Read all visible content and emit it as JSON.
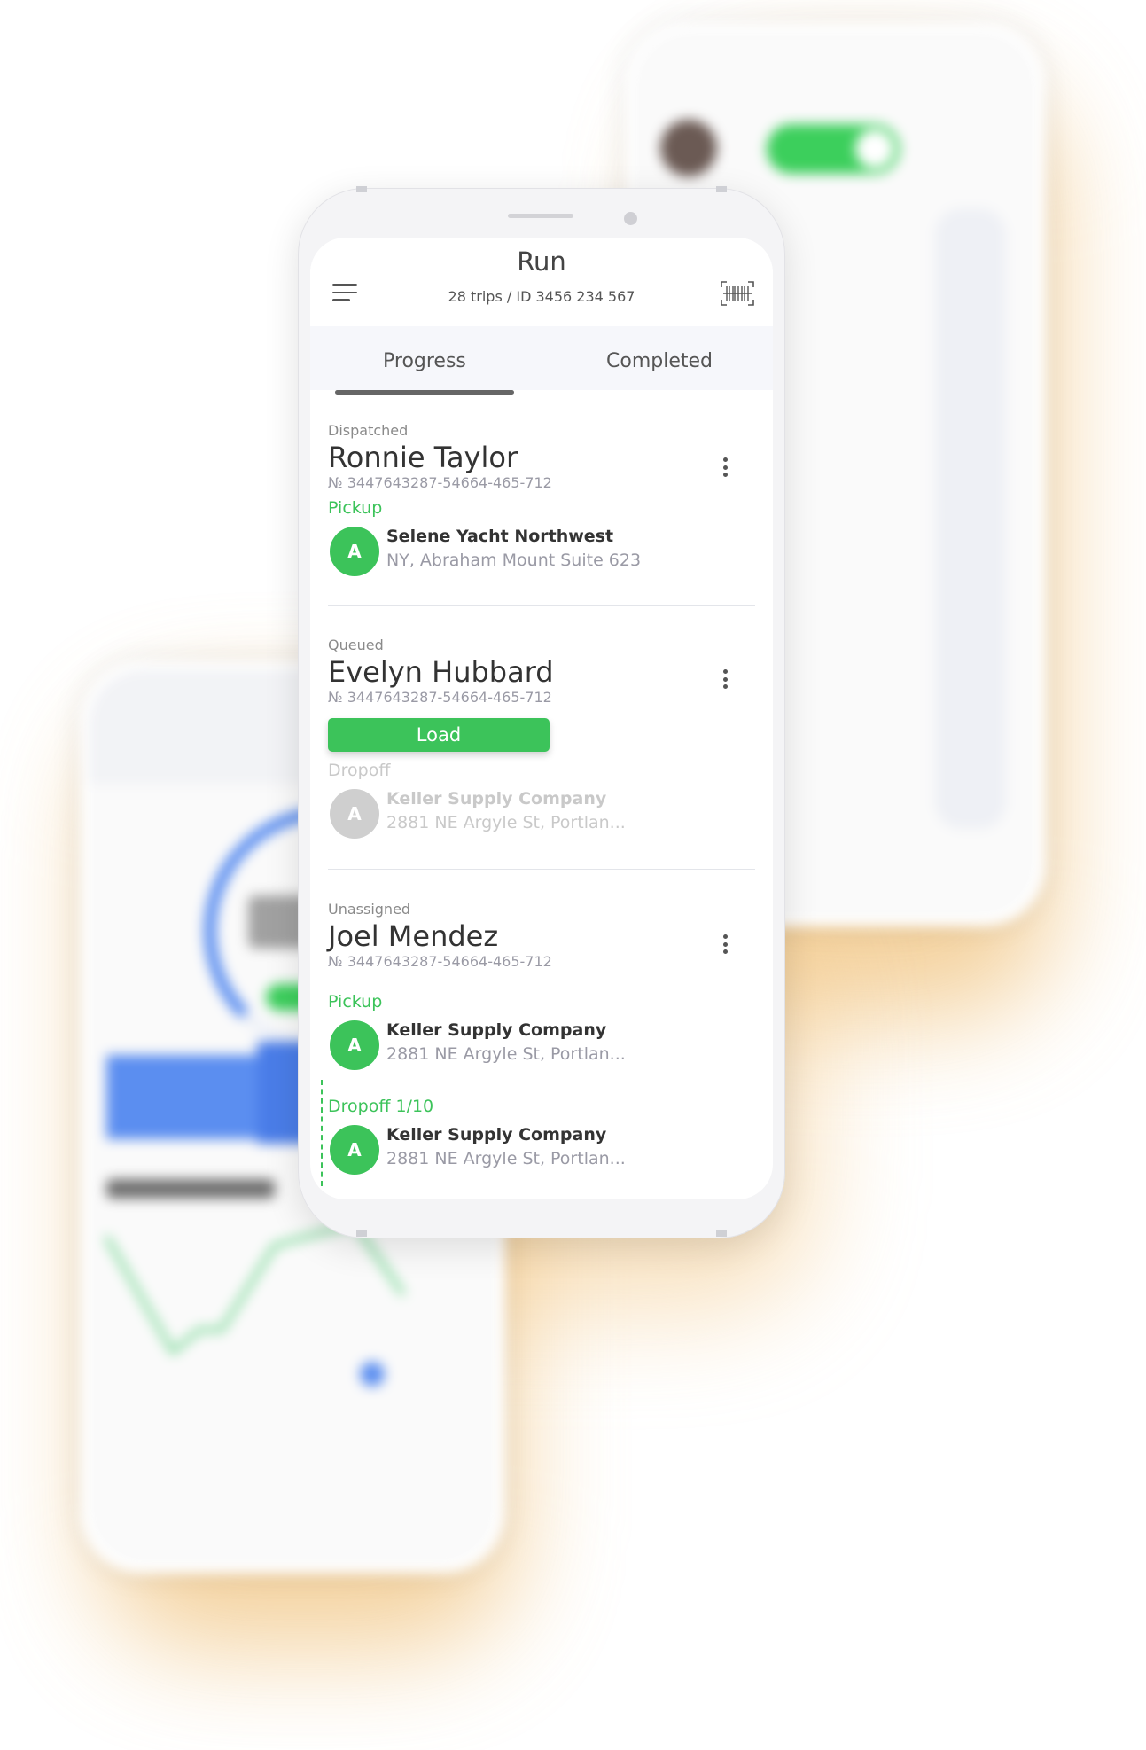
{
  "header": {
    "title": "Run",
    "subtitle": "28 trips / ID 3456 234 567"
  },
  "tabs": [
    {
      "label": "Progress",
      "active": true
    },
    {
      "label": "Completed",
      "active": false
    }
  ],
  "runs": [
    {
      "status": "Dispatched",
      "name": "Ronnie Taylor",
      "trip_no": "№ 3447643287-54664-465-712",
      "stops": [
        {
          "label": "Pickup",
          "badge": "A",
          "company": "Selene Yacht Northwest",
          "address": "NY, Abraham Mount Suite 623"
        }
      ]
    },
    {
      "status": "Queued",
      "name": "Evelyn Hubbard",
      "trip_no": "№ 3447643287-54664-465-712",
      "action_label": "Load",
      "stops": [
        {
          "label": "Dropoff",
          "badge": "A",
          "company": "Keller Supply Company",
          "address": "2881 NE Argyle St, Portlan..."
        }
      ]
    },
    {
      "status": "Unassigned",
      "name": "Joel Mendez",
      "trip_no": "№ 3447643287-54664-465-712",
      "stops": [
        {
          "label": "Pickup",
          "badge": "A",
          "company": "Keller Supply Company",
          "address": "2881 NE Argyle St, Portlan..."
        },
        {
          "label": "Dropoff 1/10",
          "badge": "A",
          "company": "Keller Supply Company",
          "address": "2881 NE Argyle St, Portlan..."
        }
      ]
    }
  ],
  "colors": {
    "accent_green": "#3cc35a",
    "muted_gray": "#c9c9c9",
    "background_glow": "#f0c27c",
    "chart_blue": "#5b8ef0"
  },
  "icons": [
    "menu-icon",
    "barcode-icon",
    "more-vertical-icon"
  ]
}
